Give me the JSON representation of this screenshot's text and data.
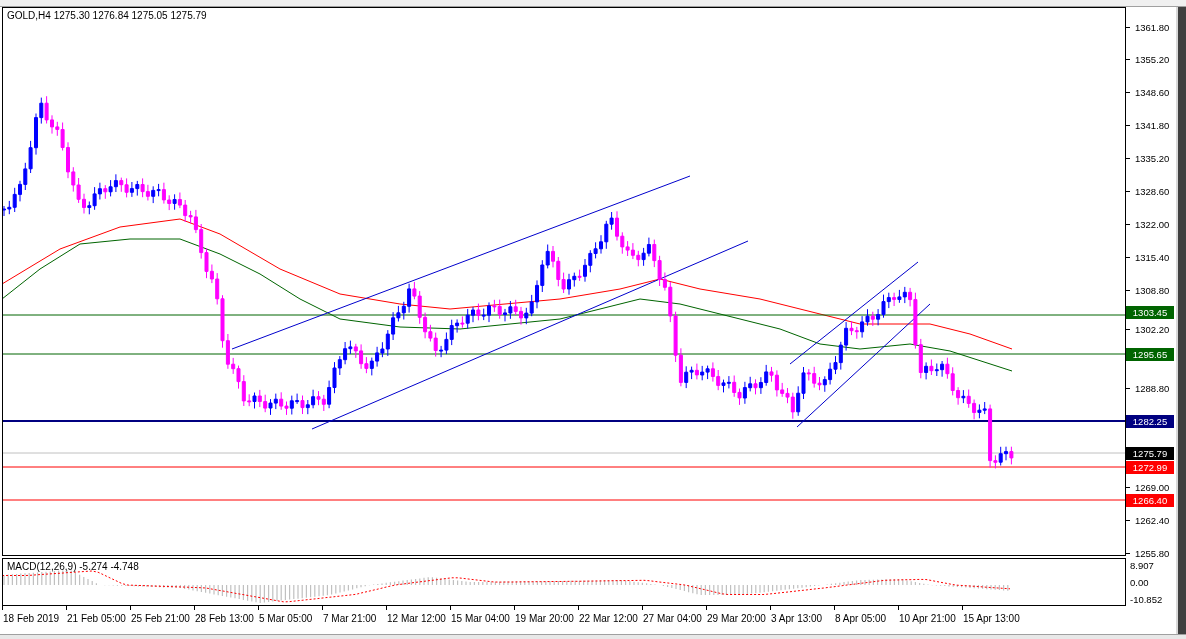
{
  "chart_header": "GOLD,H4  1275.30 1276.84 1275.05 1275.79",
  "price_axis": [
    "1361.80",
    "1355.20",
    "1348.60",
    "1341.80",
    "1335.20",
    "1328.60",
    "1322.00",
    "1315.40",
    "1308.80",
    "1302.20",
    "1288.80",
    "1269.00",
    "1262.40",
    "1255.80"
  ],
  "price_levels": [
    {
      "label": "1303.45",
      "kind": "level",
      "color": "#006400"
    },
    {
      "label": "1295.65",
      "kind": "level",
      "color": "#006400"
    },
    {
      "label": "1282.25",
      "kind": "level",
      "color": "#000080"
    },
    {
      "label": "1275.79",
      "kind": "price",
      "color": "#000000"
    },
    {
      "label": "1272.99",
      "kind": "level",
      "color": "#ff0000"
    },
    {
      "label": "1266.40",
      "kind": "level",
      "color": "#ff0000"
    }
  ],
  "macd": {
    "title": "MACD(12,26,9) -5.274 -4.748",
    "axis": [
      "8.907",
      "0.00",
      "-10.852"
    ]
  },
  "time_axis": [
    "18 Feb 2019",
    "21 Feb 05:00",
    "25 Feb 21:00",
    "28 Feb 13:00",
    "5 Mar 05:00",
    "7 Mar 21:00",
    "12 Mar 12:00",
    "15 Mar 04:00",
    "19 Mar 20:00",
    "22 Mar 12:00",
    "27 Mar 04:00",
    "29 Mar 20:00",
    "3 Apr 13:00",
    "8 Apr 05:00",
    "10 Apr 21:00",
    "15 Apr 13:00"
  ]
}
